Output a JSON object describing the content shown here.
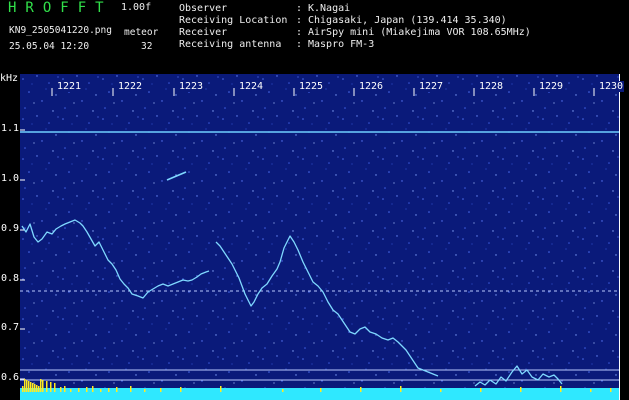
{
  "header": {
    "app_title": "HROFFT",
    "version": "1.00f",
    "filename": "KN9_2505041220.png",
    "datetime": "25.05.04 12:20",
    "meteor_label": "meteor",
    "meteor_count": "32"
  },
  "info": [
    {
      "label": "Observer",
      "value": "K.Nagai"
    },
    {
      "label": "Receiving Location",
      "value": "Chigasaki, Japan (139.414 35.340)"
    },
    {
      "label": "Receiver",
      "value": "AirSpy mini (Miakejima VOR 108.65MHz)"
    },
    {
      "label": "Receiving antenna",
      "value": "Maspro FM-3"
    }
  ],
  "axis": {
    "unit": "kHz",
    "y_ticks": [
      "1.1",
      "1.0",
      "0.9",
      "0.8",
      "0.7",
      "0.6"
    ],
    "x_ticks": [
      "1221",
      "1222",
      "1223",
      "1224",
      "1225",
      "1226",
      "1227",
      "1228",
      "1229",
      "1230"
    ]
  },
  "colors": {
    "background": "#0a1a7a",
    "signal": "#7fd8ff",
    "grid": "#b8c8ff",
    "title_green": "#31e04a",
    "bottom_bar": "#2fe8ff",
    "bottom_spikes": "#ffea20"
  }
}
